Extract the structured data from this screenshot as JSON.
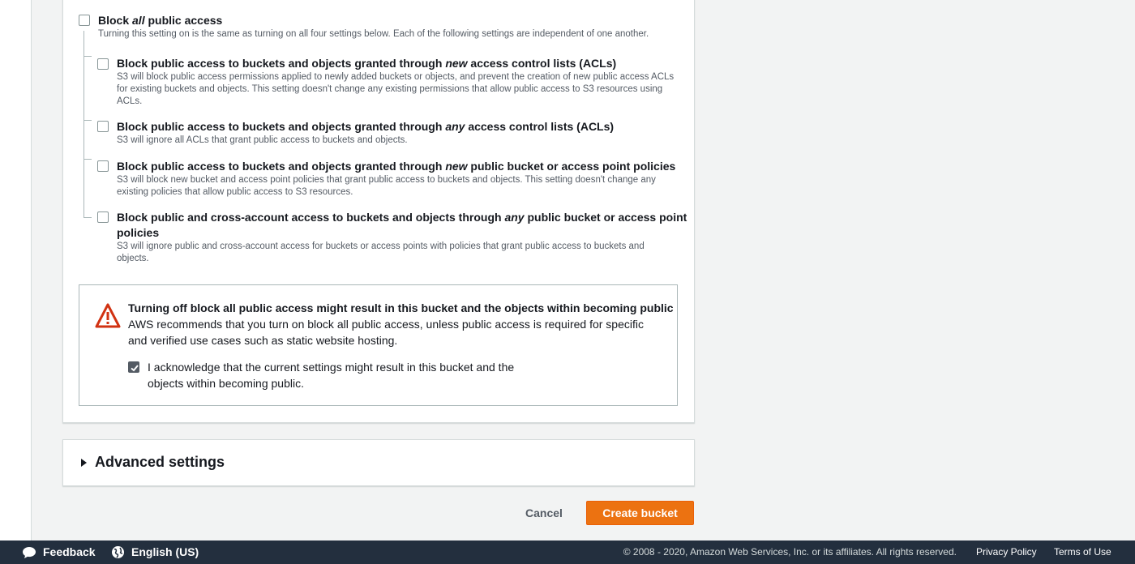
{
  "block_all": {
    "title_prefix": "Block ",
    "title_em": "all",
    "title_suffix": " public access",
    "description": "Turning this setting on is the same as turning on all four settings below. Each of the following settings are independent of one another.",
    "checked": false
  },
  "options": [
    {
      "title_prefix": "Block public access to buckets and objects granted through ",
      "title_em": "new",
      "title_suffix": " access control lists (ACLs)",
      "description": "S3 will block public access permissions applied to newly added buckets or objects, and prevent the creation of new public access ACLs for existing buckets and objects. This setting doesn't change any existing permissions that allow public access to S3 resources using ACLs.",
      "checked": false
    },
    {
      "title_prefix": "Block public access to buckets and objects granted through ",
      "title_em": "any",
      "title_suffix": " access control lists (ACLs)",
      "description": "S3 will ignore all ACLs that grant public access to buckets and objects.",
      "checked": false
    },
    {
      "title_prefix": "Block public access to buckets and objects granted through ",
      "title_em": "new",
      "title_suffix": " public bucket or access point policies",
      "description": "S3 will block new bucket and access point policies that grant public access to buckets and objects. This setting doesn't change any existing policies that allow public access to S3 resources.",
      "checked": false
    },
    {
      "title_prefix": "Block public and cross-account access to buckets and objects through ",
      "title_em": "any",
      "title_suffix": " public bucket or access point",
      "title_line2": "policies",
      "description": "S3 will ignore public and cross-account access for buckets or access points with policies that grant public access to buckets and objects.",
      "checked": false
    }
  ],
  "warning": {
    "icon": "warning-triangle-icon",
    "title": "Turning off block all public access might result in this bucket and the objects within becoming public",
    "body": "AWS recommends that you turn on block all public access, unless public access is required for specific and verified use cases such as static website hosting.",
    "ack_label": "I acknowledge that the current settings might result in this bucket and the objects within becoming public.",
    "ack_checked": true,
    "color": "#d13212"
  },
  "advanced": {
    "label": "Advanced settings",
    "icon": "caret-right-icon"
  },
  "actions": {
    "cancel_label": "Cancel",
    "create_label": "Create bucket",
    "primary_color": "#ec7211"
  },
  "footer": {
    "feedback_label": "Feedback",
    "feedback_icon": "speech-bubble-icon",
    "language_label": "English (US)",
    "language_icon": "globe-icon",
    "copyright": "© 2008 - 2020, Amazon Web Services, Inc. or its affiliates. All rights reserved.",
    "privacy_label": "Privacy Policy",
    "terms_label": "Terms of Use",
    "background": "#232f3e"
  }
}
